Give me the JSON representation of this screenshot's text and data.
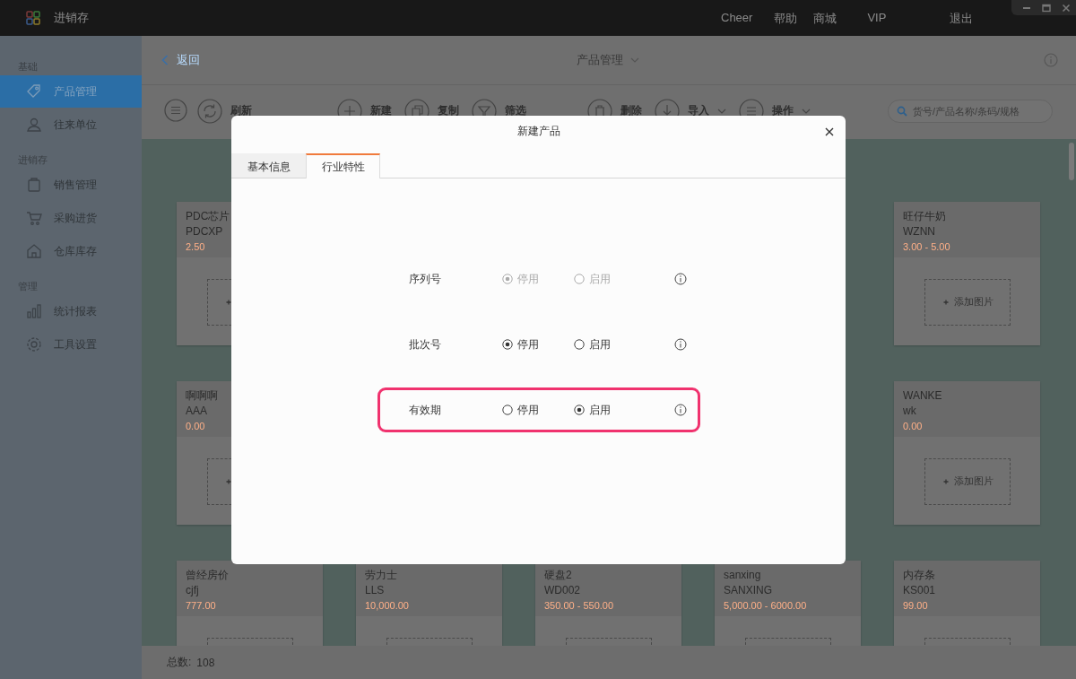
{
  "window": {
    "title": "进销存",
    "nav": [
      "Cheer",
      "帮助",
      "商城",
      "VIP",
      "退出"
    ]
  },
  "sidebar": {
    "sections": [
      {
        "title": "基础",
        "items": [
          {
            "label": "产品管理",
            "selected": true
          },
          {
            "label": "往来单位",
            "selected": false
          }
        ]
      },
      {
        "title": "进销存",
        "items": [
          {
            "label": "销售管理",
            "selected": false
          },
          {
            "label": "采购进货",
            "selected": false
          },
          {
            "label": "仓库库存",
            "selected": false
          }
        ]
      },
      {
        "title": "管理",
        "items": [
          {
            "label": "统计报表",
            "selected": false
          },
          {
            "label": "工具设置",
            "selected": false
          }
        ]
      }
    ]
  },
  "header": {
    "back": "返回",
    "title": "产品管理"
  },
  "toolbar": {
    "groups": [
      [
        {
          "label": "刷新",
          "caret": false
        }
      ],
      [
        {
          "label": "新建",
          "caret": false
        },
        {
          "label": "复制",
          "caret": false
        },
        {
          "label": "筛选",
          "caret": false
        }
      ],
      [
        {
          "label": "删除",
          "caret": false
        },
        {
          "label": "导入",
          "caret": true
        },
        {
          "label": "操作",
          "caret": true
        }
      ]
    ],
    "search": {
      "placeholder": "货号/产品名称/条码/规格"
    }
  },
  "product_rows": [
    [
      {
        "name": "PDC芯片",
        "code": "PDCXP",
        "price": "2.50"
      },
      {
        "name": "旺仔牛奶",
        "code": "WZNN",
        "price": "3.00 - 5.00",
        "add_label": "添加图片"
      }
    ],
    [
      {
        "name": "啊啊啊",
        "code": "AAA",
        "price": "0.00"
      },
      {
        "name": "WANKE",
        "code": "wk",
        "price": "0.00",
        "add_label": "添加图片"
      }
    ],
    [
      {
        "name": "曾经房价",
        "code": "cjfj",
        "price": "777.00"
      },
      {
        "name": "劳力士",
        "code": "LLS",
        "price": "10,000.00"
      },
      {
        "name": "硬盘2",
        "code": "WD002",
        "price": "350.00 - 550.00"
      },
      {
        "name": "sanxing",
        "code": "SANXING",
        "price": "5,000.00 - 6000.00"
      },
      {
        "name": "内存条",
        "code": "KS001",
        "price": "99.00"
      }
    ]
  ],
  "footer": {
    "label": "总数:",
    "count": "108"
  },
  "dialog": {
    "title": "新建产品",
    "tabs": [
      {
        "label": "基本信息",
        "selected": false
      },
      {
        "label": "行业特性",
        "selected": true
      }
    ],
    "settings": [
      {
        "label": "序列号",
        "disabled": true,
        "highlighted": false,
        "options": [
          {
            "label": "停用",
            "selected": true
          },
          {
            "label": "启用",
            "selected": false
          }
        ]
      },
      {
        "label": "批次号",
        "disabled": false,
        "highlighted": false,
        "options": [
          {
            "label": "停用",
            "selected": true
          },
          {
            "label": "启用",
            "selected": false
          }
        ]
      },
      {
        "label": "有效期",
        "disabled": false,
        "highlighted": true,
        "options": [
          {
            "label": "停用",
            "selected": false
          },
          {
            "label": "启用",
            "selected": true
          }
        ]
      }
    ]
  }
}
